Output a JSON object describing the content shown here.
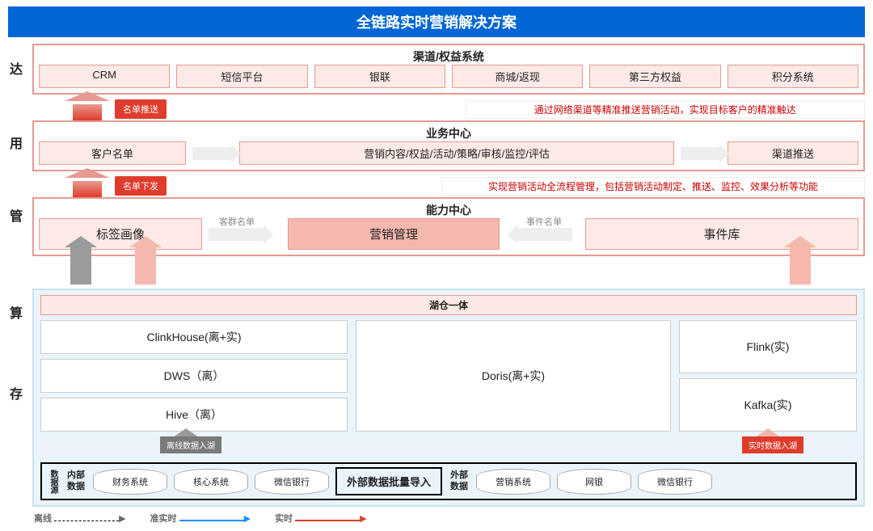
{
  "title": "全链路实时营销解决方案",
  "sideLabels": [
    "达",
    "用",
    "管",
    "算",
    "存"
  ],
  "channel": {
    "title": "渠道/权益系统",
    "items": [
      "CRM",
      "短信平台",
      "银联",
      "商城/返现",
      "第三方权益",
      "积分系统"
    ],
    "note": "通过网络渠道等精准推送营销活动，实现目标客户的精准触达"
  },
  "arrow1": "名单推送",
  "biz": {
    "title": "业务中心",
    "left": "客户名单",
    "mid": "营销内容/权益/活动/策略/审核/监控/评估",
    "right": "渠道推送",
    "note": "实现营销活动全流程管理，包括营销活动制定、推送、监控、效果分析等功能"
  },
  "arrow2": "名单下发",
  "cap": {
    "title": "能力中心",
    "left": "标签画像",
    "leftArrow": "客群名单",
    "mid": "营销管理",
    "rightArrow": "事件名单",
    "right": "事件库"
  },
  "lake": {
    "title": "湖仓一体",
    "left": [
      "ClinkHouse(离+实)",
      "DWS（离）",
      "Hive（离）"
    ],
    "mid": "Doris(离+实)",
    "right": [
      "Flink(实)",
      "Kafka(实)"
    ]
  },
  "bottomTags": {
    "gray": "离线数据入湖",
    "red": "实时数据入湖"
  },
  "dataRow": {
    "side": "数据源",
    "grp1": "内部\n数据",
    "cyl1": [
      "财务系统",
      "核心系统",
      "微信银行"
    ],
    "mid": "外部数据批量导入",
    "grp2": "外部\n数据",
    "cyl2": [
      "营销系统",
      "网银",
      "微信银行"
    ]
  },
  "legend": [
    "离线",
    "准实时",
    "实时"
  ]
}
